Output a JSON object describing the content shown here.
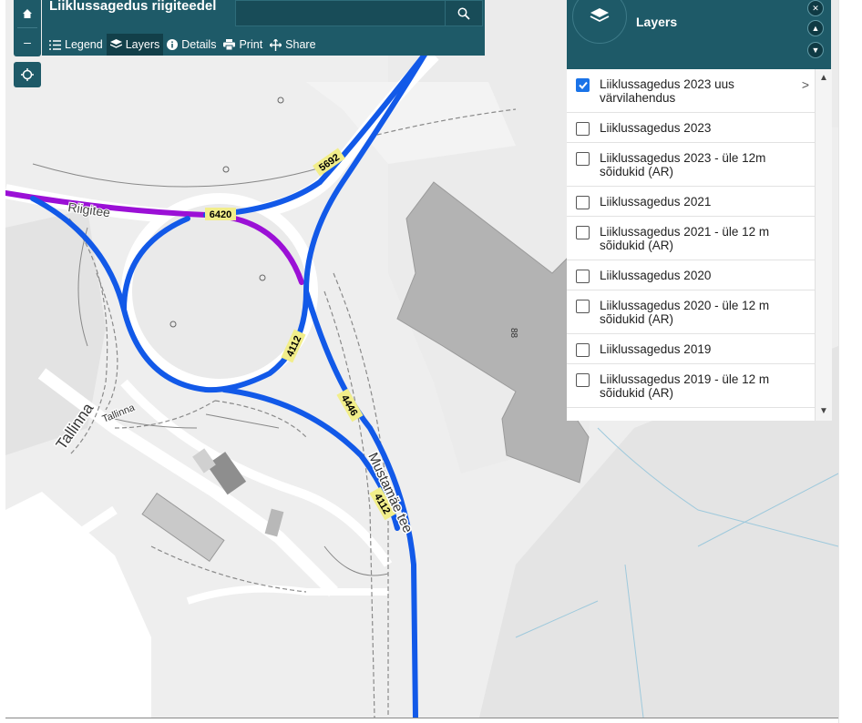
{
  "app": {
    "title": "Liiklussagedus riigiteedel",
    "search_placeholder": "",
    "accent_color": "#1e5a68"
  },
  "zoom": {
    "in_icon": "home-icon",
    "out_label": "–"
  },
  "toolbar": {
    "items": [
      {
        "label": "Legend",
        "icon": "list-icon",
        "active": false
      },
      {
        "label": "Layers",
        "icon": "layers-icon",
        "active": true
      },
      {
        "label": "Details",
        "icon": "info-icon",
        "active": false
      },
      {
        "label": "Print",
        "icon": "print-icon",
        "active": false
      },
      {
        "label": "Share",
        "icon": "share-icon",
        "active": false
      }
    ]
  },
  "layers_panel": {
    "title": "Layers",
    "items": [
      {
        "label": "Liiklussagedus 2023 uus värvilahendus",
        "checked": true,
        "has_sublayers": true
      },
      {
        "label": "Liiklussagedus 2023",
        "checked": false
      },
      {
        "label": "Liiklussagedus 2023 - üle 12m sõidukid (AR)",
        "checked": false
      },
      {
        "label": "Liiklussagedus 2021",
        "checked": false
      },
      {
        "label": "Liiklussagedus 2021 - üle 12 m sõidukid (AR)",
        "checked": false
      },
      {
        "label": "Liiklussagedus 2020",
        "checked": false
      },
      {
        "label": "Liiklussagedus 2020 - üle 12 m sõidukid (AR)",
        "checked": false
      },
      {
        "label": "Liiklussagedus 2019",
        "checked": false
      },
      {
        "label": "Liiklussagedus 2019 - üle 12 m sõidukid (AR)",
        "checked": false
      }
    ]
  },
  "map": {
    "colors": {
      "background": "#eeeeee",
      "block": "#e2e2e2",
      "building": "#b3b3b3",
      "road_casing": "#cfcfcf",
      "traffic_blue": "#1259e8",
      "traffic_purple": "#9b10d6",
      "label_bg": "#f2ee8a"
    },
    "traffic_labels": [
      "6420",
      "5692",
      "4112",
      "4446",
      "4112"
    ],
    "street_labels": [
      "Tallinna",
      "Tallinna",
      "Riigitee",
      "Mustamäe tee"
    ],
    "building_number": "88"
  }
}
